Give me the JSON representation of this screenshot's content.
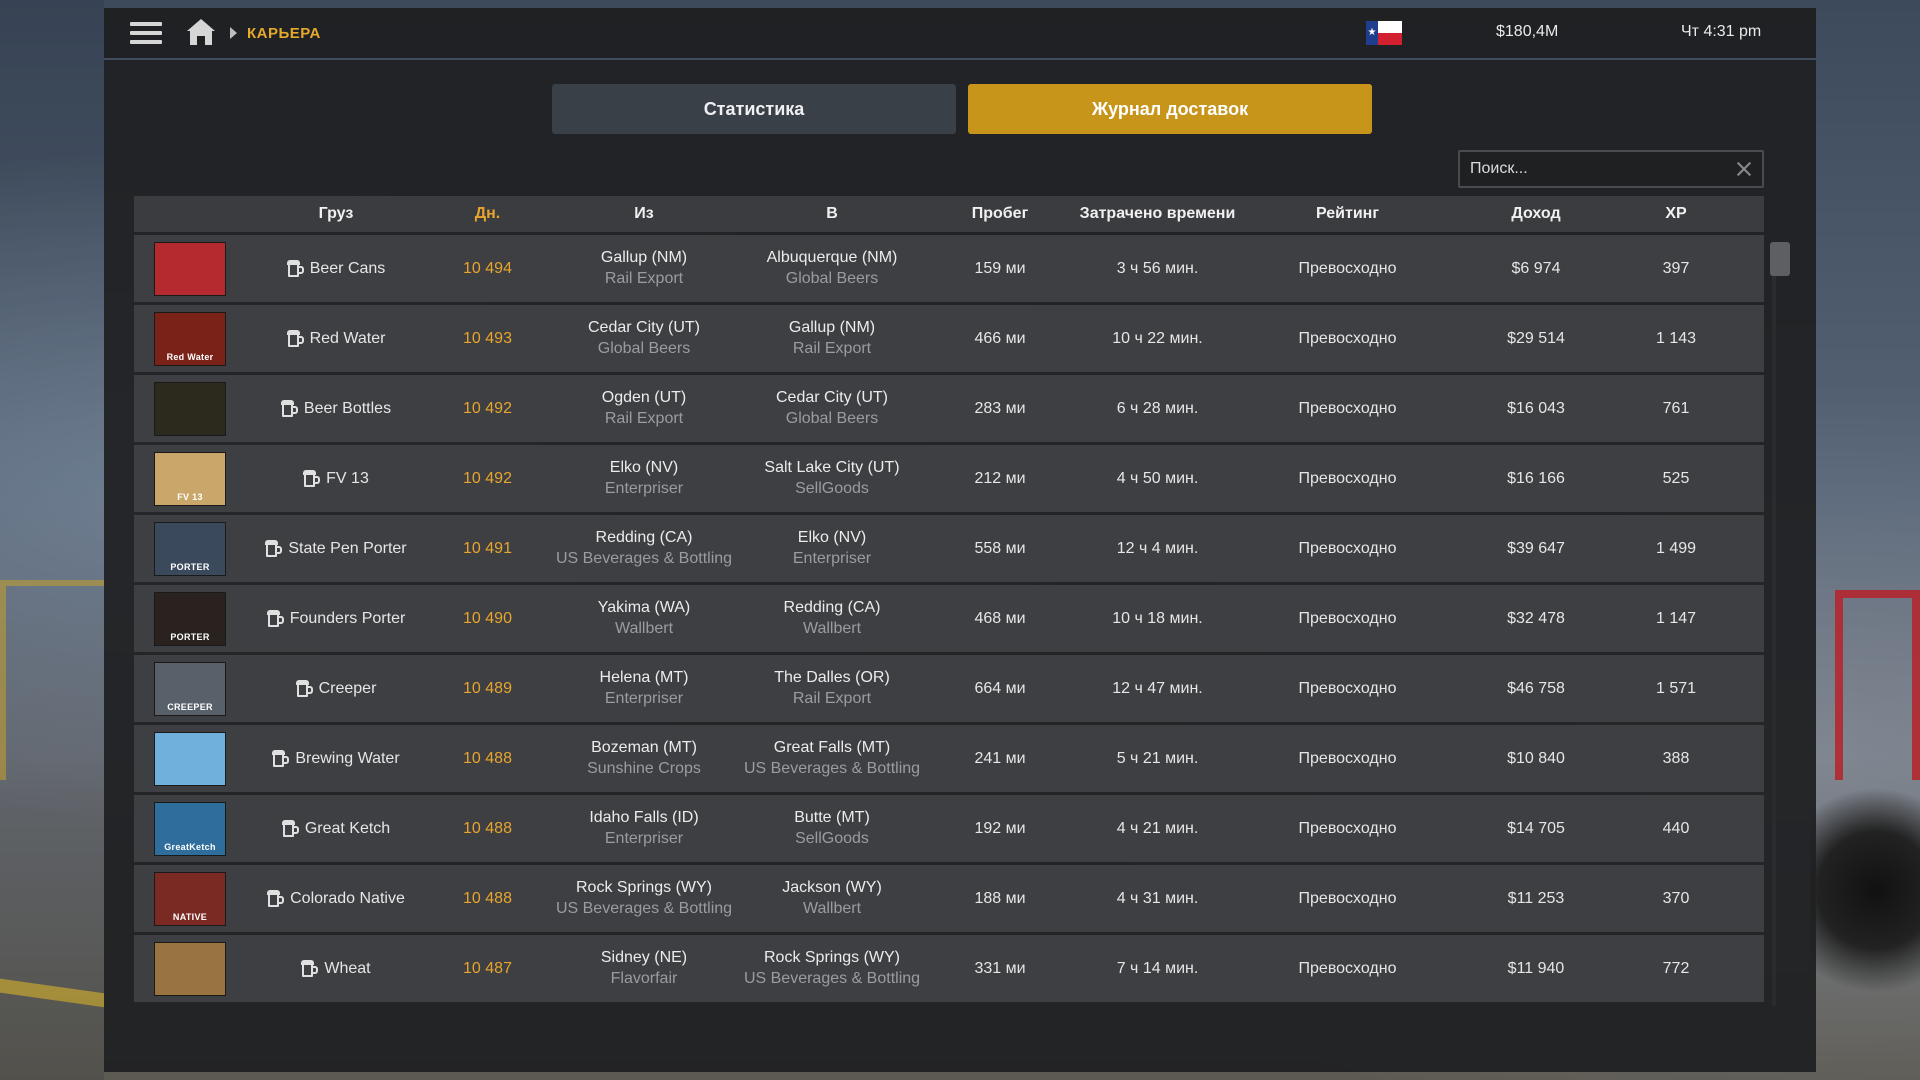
{
  "topbar": {
    "breadcrumb": "КАРЬЕРА",
    "money": "$180,4M",
    "clock": "Чт 4:31 pm",
    "flag_colors": [
      "#1f3f8e",
      "#ffffff",
      "#d22030"
    ]
  },
  "tabs": {
    "stats": "Статистика",
    "log": "Журнал доставок"
  },
  "search": {
    "placeholder": "Поиск..."
  },
  "colors": {
    "accent": "#c7951a",
    "days": "#e8a52d"
  },
  "table": {
    "headers": {
      "cargo": "Груз",
      "days": "Дн.",
      "from": "Из",
      "to": "В",
      "distance": "Пробег",
      "time": "Затрачено времени",
      "rating": "Рейтинг",
      "income": "Доход",
      "xp": "XP"
    },
    "rows": [
      {
        "cargo": "Beer Cans",
        "days": "10 494",
        "from_city": "Gallup (NM)",
        "from_company": "Rail Export",
        "to_city": "Albuquerque (NM)",
        "to_company": "Global Beers",
        "distance": "159 ми",
        "time": "3 ч 56 мин.",
        "rating": "Превосходно",
        "income": "$6 974",
        "xp": "397",
        "thumb_color": "#b42a2e",
        "thumb_label": ""
      },
      {
        "cargo": "Red Water",
        "days": "10 493",
        "from_city": "Cedar City (UT)",
        "from_company": "Global Beers",
        "to_city": "Gallup (NM)",
        "to_company": "Rail Export",
        "distance": "466 ми",
        "time": "10 ч 22 мин.",
        "rating": "Превосходно",
        "income": "$29 514",
        "xp": "1 143",
        "thumb_color": "#7b2218",
        "thumb_label": "Red Water"
      },
      {
        "cargo": "Beer Bottles",
        "days": "10 492",
        "from_city": "Ogden (UT)",
        "from_company": "Rail Export",
        "to_city": "Cedar City (UT)",
        "to_company": "Global Beers",
        "distance": "283 ми",
        "time": "6 ч 28 мин.",
        "rating": "Превосходно",
        "income": "$16 043",
        "xp": "761",
        "thumb_color": "#2b2a1c",
        "thumb_label": ""
      },
      {
        "cargo": "FV 13",
        "days": "10 492",
        "from_city": "Elko (NV)",
        "from_company": "Enterpriser",
        "to_city": "Salt Lake City (UT)",
        "to_company": "SellGoods",
        "distance": "212 ми",
        "time": "4 ч 50 мин.",
        "rating": "Превосходно",
        "income": "$16 166",
        "xp": "525",
        "thumb_color": "#c9a76a",
        "thumb_label": "FV 13"
      },
      {
        "cargo": "State Pen Porter",
        "days": "10 491",
        "from_city": "Redding (CA)",
        "from_company": "US Beverages & Bottling",
        "to_city": "Elko (NV)",
        "to_company": "Enterpriser",
        "distance": "558 ми",
        "time": "12 ч 4 мин.",
        "rating": "Превосходно",
        "income": "$39 647",
        "xp": "1 499",
        "thumb_color": "#3a4a5c",
        "thumb_label": "PORTER"
      },
      {
        "cargo": "Founders Porter",
        "days": "10 490",
        "from_city": "Yakima (WA)",
        "from_company": "Wallbert",
        "to_city": "Redding (CA)",
        "to_company": "Wallbert",
        "distance": "468 ми",
        "time": "10 ч 18 мин.",
        "rating": "Превосходно",
        "income": "$32 478",
        "xp": "1 147",
        "thumb_color": "#2a221e",
        "thumb_label": "PORTER"
      },
      {
        "cargo": "Creeper",
        "days": "10 489",
        "from_city": "Helena (MT)",
        "from_company": "Enterpriser",
        "to_city": "The Dalles (OR)",
        "to_company": "Rail Export",
        "distance": "664 ми",
        "time": "12 ч 47 мин.",
        "rating": "Превосходно",
        "income": "$46 758",
        "xp": "1 571",
        "thumb_color": "#58606a",
        "thumb_label": "CREEPER"
      },
      {
        "cargo": "Brewing Water",
        "days": "10 488",
        "from_city": "Bozeman (MT)",
        "from_company": "Sunshine Crops",
        "to_city": "Great Falls (MT)",
        "to_company": "US Beverages & Bottling",
        "distance": "241 ми",
        "time": "5 ч 21 мин.",
        "rating": "Превосходно",
        "income": "$10 840",
        "xp": "388",
        "thumb_color": "#6fb1dc",
        "thumb_label": ""
      },
      {
        "cargo": "Great Ketch",
        "days": "10 488",
        "from_city": "Idaho Falls (ID)",
        "from_company": "Enterpriser",
        "to_city": "Butte (MT)",
        "to_company": "SellGoods",
        "distance": "192 ми",
        "time": "4 ч 21 мин.",
        "rating": "Превосходно",
        "income": "$14 705",
        "xp": "440",
        "thumb_color": "#2f6d9c",
        "thumb_label": "GreatKetch"
      },
      {
        "cargo": "Colorado Native",
        "days": "10 488",
        "from_city": "Rock Springs (WY)",
        "from_company": "US Beverages & Bottling",
        "to_city": "Jackson (WY)",
        "to_company": "Wallbert",
        "distance": "188 ми",
        "time": "4 ч 31 мин.",
        "rating": "Превосходно",
        "income": "$11 253",
        "xp": "370",
        "thumb_color": "#7a2a22",
        "thumb_label": "NATIVE"
      },
      {
        "cargo": "Wheat",
        "days": "10 487",
        "from_city": "Sidney (NE)",
        "from_company": "Flavorfair",
        "to_city": "Rock Springs (WY)",
        "to_company": "US Beverages & Bottling",
        "distance": "331 ми",
        "time": "7 ч 14 мин.",
        "rating": "Превосходно",
        "income": "$11 940",
        "xp": "772",
        "thumb_color": "#9a7440",
        "thumb_label": ""
      }
    ]
  }
}
